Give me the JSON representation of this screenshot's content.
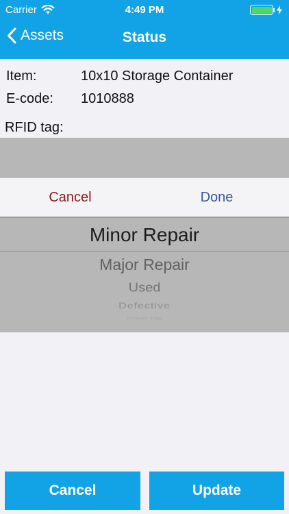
{
  "status_bar": {
    "carrier": "Carrier",
    "time": "4:49 PM",
    "battery_color": "#4cd964"
  },
  "nav": {
    "back_label": "Assets",
    "title": "Status"
  },
  "info": {
    "item_label": "Item:",
    "item_value": "10x10 Storage Container",
    "ecode_label": "E-code:",
    "ecode_value": "1010888",
    "rfid_label": "RFID tag:"
  },
  "picker_toolbar": {
    "cancel_label": "Cancel",
    "done_label": "Done"
  },
  "picker_options": [
    "Minor Repair",
    "Major Repair",
    "Used",
    "Defective",
    "Good Tag"
  ],
  "picker_selected": "Minor Repair",
  "buttons": {
    "cancel_label": "Cancel",
    "update_label": "Update"
  },
  "colors": {
    "accent": "#12a3e6",
    "toolbar_cancel": "#8b1a1a",
    "toolbar_done": "#34599a"
  }
}
